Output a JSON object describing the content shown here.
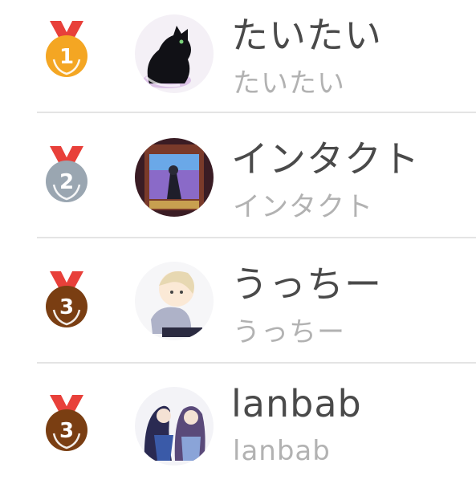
{
  "ranking": {
    "entries": [
      {
        "rank": "1",
        "medal": "gold-medal",
        "name": "たいたい",
        "subname": "たいたい"
      },
      {
        "rank": "2",
        "medal": "silver-medal",
        "name": "インタクト",
        "subname": "インタクト"
      },
      {
        "rank": "3",
        "medal": "bronze-medal",
        "name": "うっちー",
        "subname": "うっちー"
      },
      {
        "rank": "3",
        "medal": "bronze-medal",
        "name": "lanbab",
        "subname": "lanbab"
      }
    ]
  },
  "colors": {
    "ribbon": "#e8403a",
    "gold": "#f4a623",
    "silver": "#9aa6b1",
    "bronze": "#7a3e12",
    "name_text": "#4a4a4a",
    "sub_text": "#b2b2b2",
    "divider": "#e4e4e4"
  }
}
